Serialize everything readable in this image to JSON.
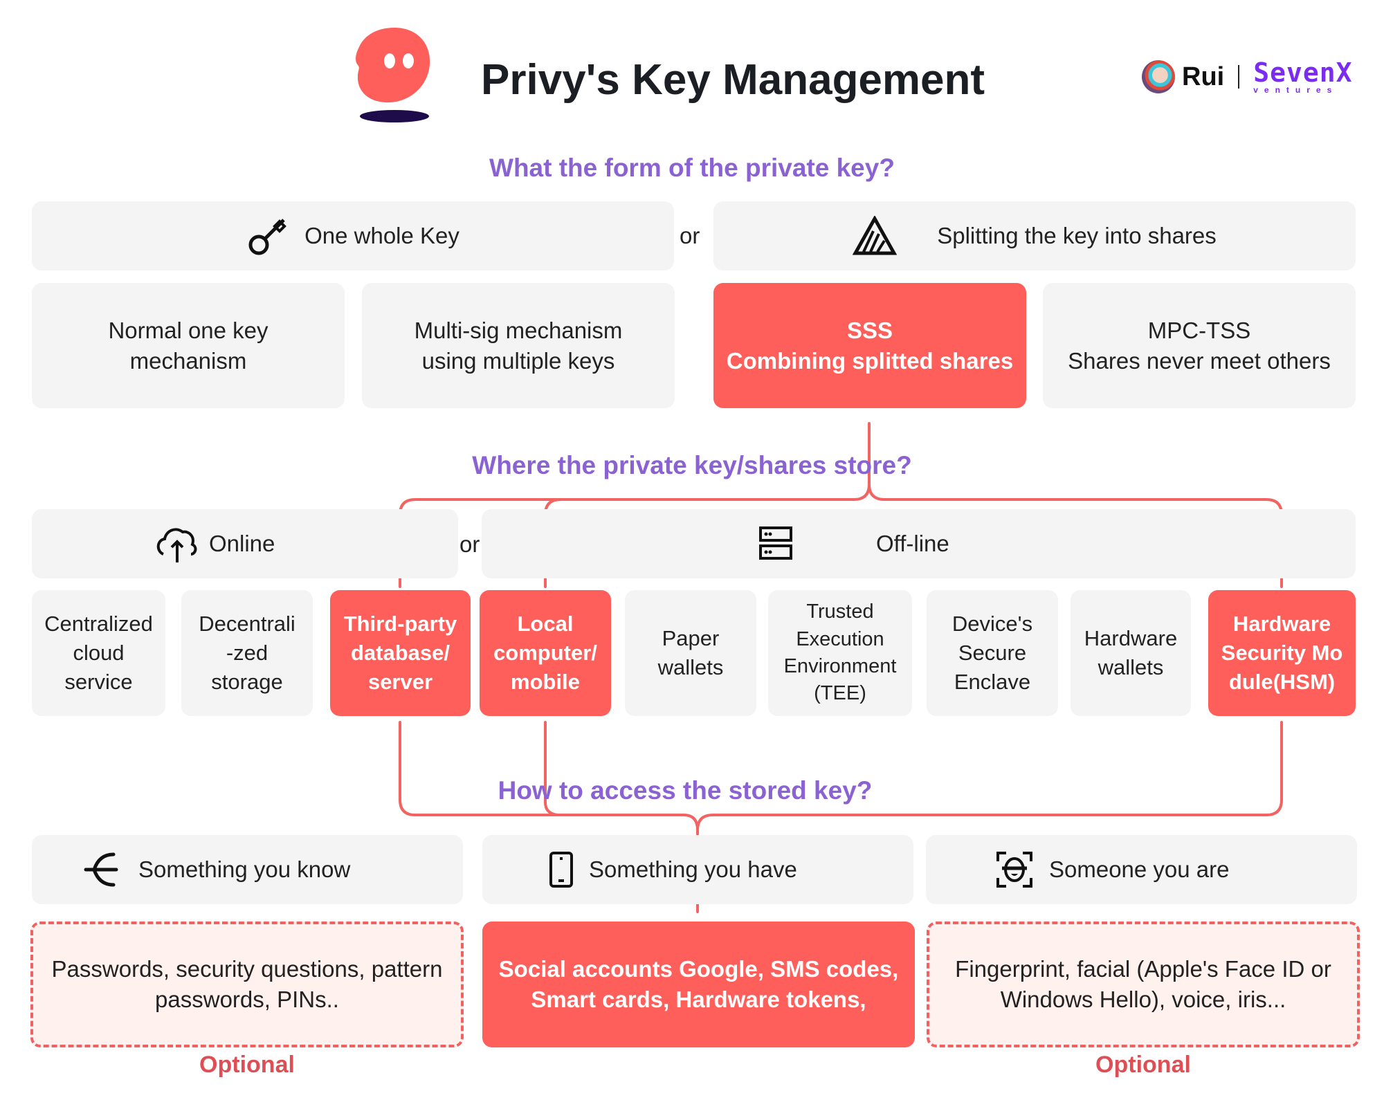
{
  "header": {
    "title": "Privy's Key Management",
    "author_name": "Rui",
    "brand_name": "SevenX",
    "brand_sub": "Ventures",
    "logo_icon": "privy-ghost-logo",
    "avatar_icon": "author-avatar"
  },
  "colors": {
    "accent_red": "#fe5f5b",
    "question_purple": "#8a62d2",
    "box_gray": "#f4f4f4",
    "optional_red": "#dd4f55",
    "brand_purple": "#7a2cf0"
  },
  "section1": {
    "question": "What the form of the private key?",
    "options": [
      {
        "label": "One whole Key",
        "icon": "key-icon"
      },
      {
        "label": "Splitting the key into shares",
        "icon": "split-triangle-icon"
      }
    ],
    "or": "or",
    "mechanisms": [
      {
        "line1": "Normal one key",
        "line2": "mechanism",
        "highlighted": false
      },
      {
        "line1": "Multi-sig mechanism",
        "line2": "using multiple keys",
        "highlighted": false
      },
      {
        "line1": "SSS",
        "line2": "Combining splitted shares",
        "highlighted": true
      },
      {
        "line1": "MPC-TSS",
        "line2": "Shares never meet others",
        "highlighted": false
      }
    ]
  },
  "section2": {
    "question": "Where the private key/shares store?",
    "options": [
      {
        "label": "Online",
        "icon": "cloud-upload-icon"
      },
      {
        "label": "Off-line",
        "icon": "server-icon"
      }
    ],
    "or": "or",
    "storage": [
      {
        "lines": [
          "Centralized",
          "cloud",
          "service"
        ],
        "highlighted": false
      },
      {
        "lines": [
          "Decentrali",
          "-zed",
          "storage"
        ],
        "highlighted": false
      },
      {
        "lines": [
          "Third-party",
          "database/",
          "server"
        ],
        "highlighted": true
      },
      {
        "lines": [
          "Local",
          "computer/",
          "mobile"
        ],
        "highlighted": true
      },
      {
        "lines": [
          "Paper",
          "wallets"
        ],
        "highlighted": false
      },
      {
        "lines": [
          "Trusted",
          "Execution",
          "Environment",
          "(TEE)"
        ],
        "highlighted": false
      },
      {
        "lines": [
          "Device's",
          "Secure",
          "Enclave"
        ],
        "highlighted": false
      },
      {
        "lines": [
          "Hardware",
          "wallets"
        ],
        "highlighted": false
      },
      {
        "lines": [
          "Hardware",
          "Security Mo",
          "dule(HSM)"
        ],
        "highlighted": true
      }
    ]
  },
  "section3": {
    "question": "How to access the stored key?",
    "options": [
      {
        "label": "Something you know",
        "icon": "fork-arrow-icon"
      },
      {
        "label": "Something you have",
        "icon": "phone-icon"
      },
      {
        "label": "Someone you are",
        "icon": "face-scan-icon"
      }
    ],
    "details": [
      {
        "line1": "Passwords, security questions, pattern",
        "line2": "passwords, PINs..",
        "style": "optional"
      },
      {
        "line1": "Social accounts Google, SMS codes,",
        "line2": "Smart cards, Hardware tokens,",
        "style": "highlighted"
      },
      {
        "line1": "Fingerprint, facial (Apple's Face ID or",
        "line2": "Windows Hello), voice, iris...",
        "style": "optional"
      }
    ],
    "optional_label_left": "Optional",
    "optional_label_right": "Optional"
  }
}
